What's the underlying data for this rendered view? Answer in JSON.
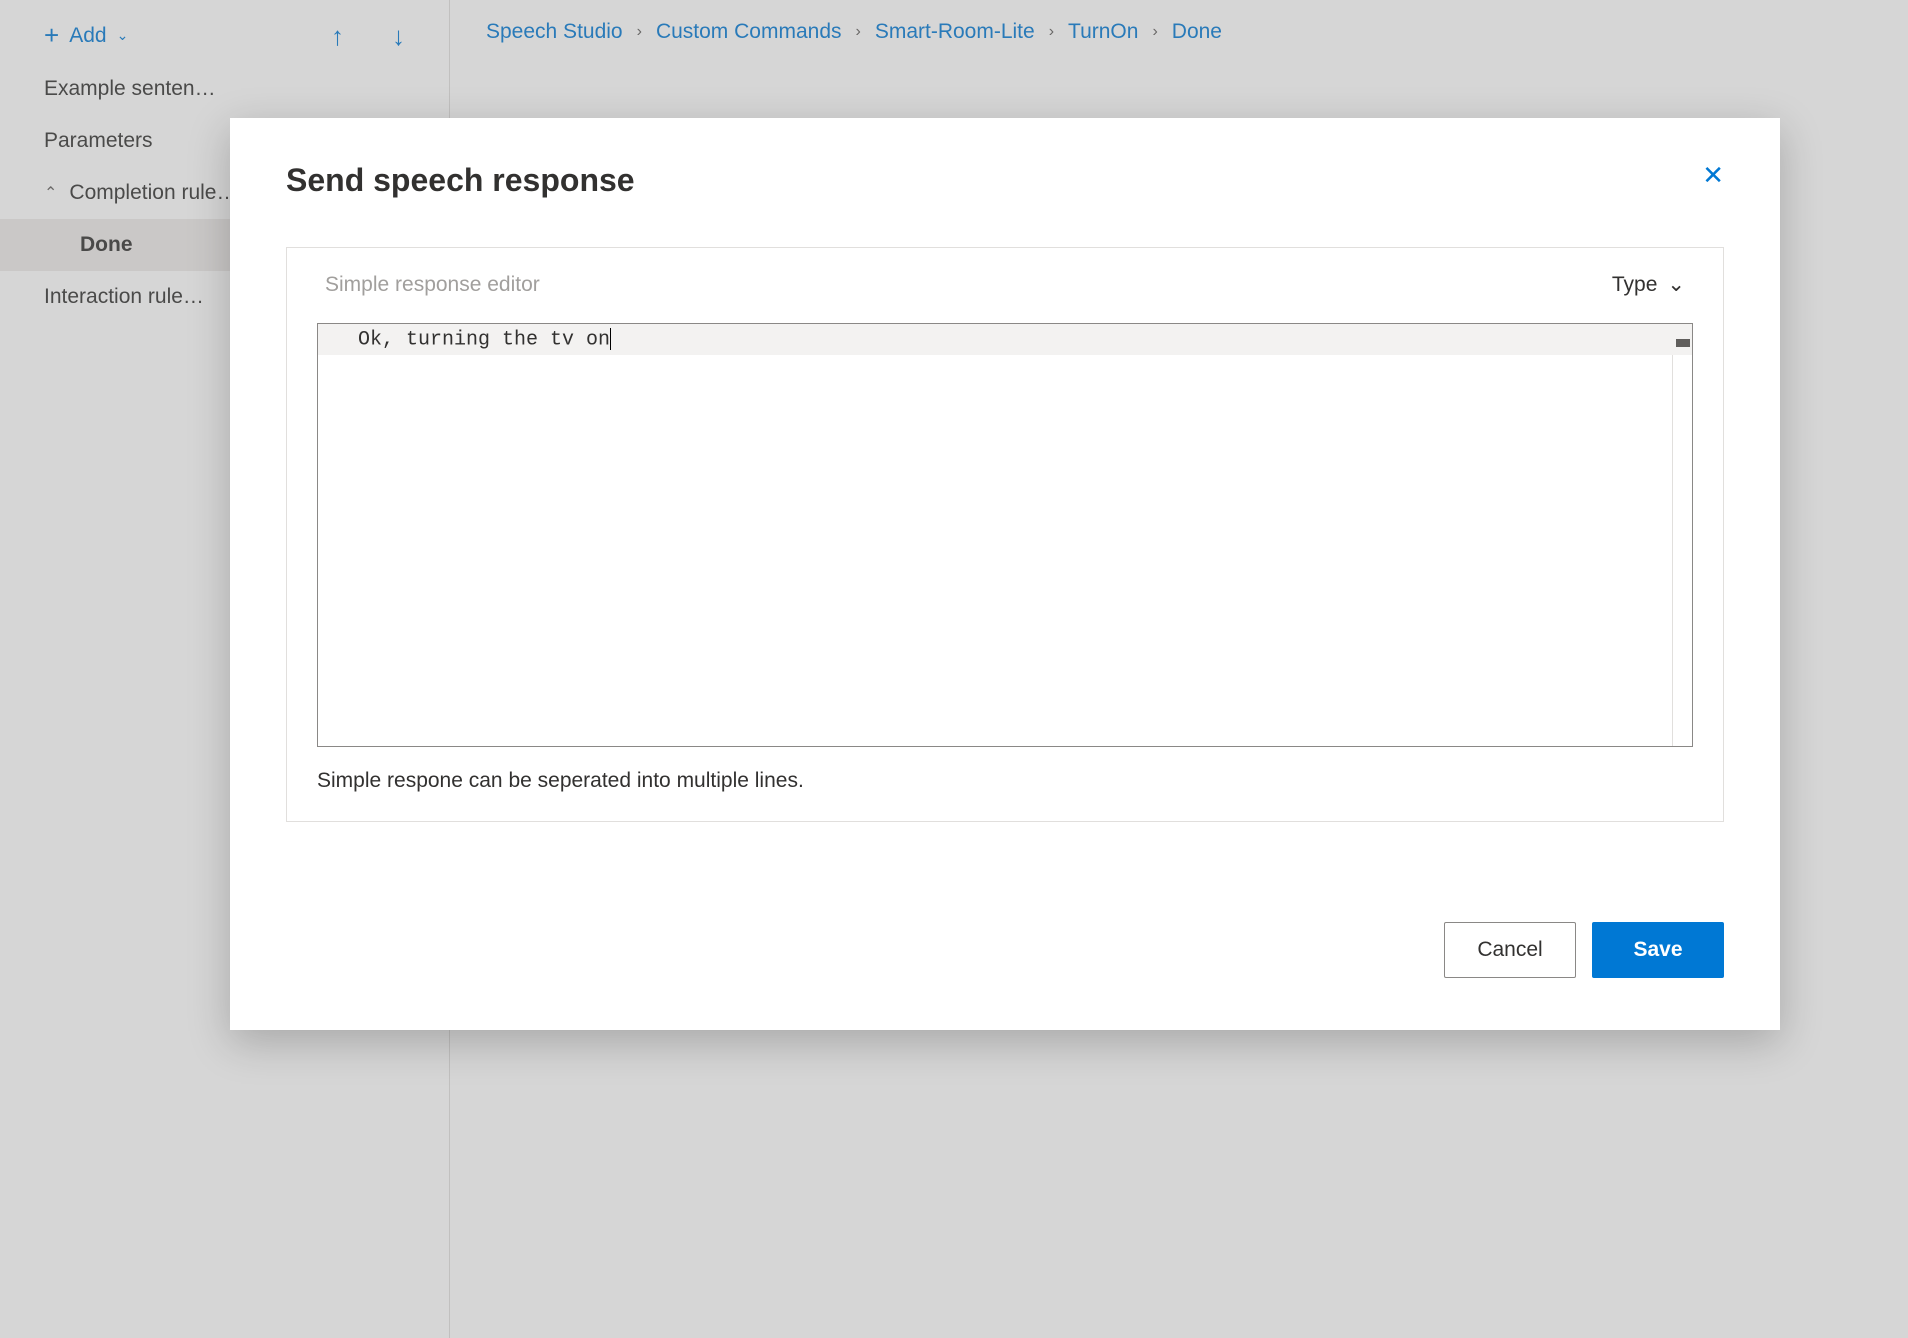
{
  "sidebar": {
    "add_label": "Add",
    "items": [
      {
        "label": "Example senten…"
      },
      {
        "label": "Parameters"
      }
    ],
    "completion_rules_label": "Completion rule…",
    "completion_subitem": "Done",
    "interaction_rules_label": "Interaction rule…"
  },
  "breadcrumb": {
    "items": [
      "Speech Studio",
      "Custom Commands",
      "Smart-Room-Lite",
      "TurnOn",
      "Done"
    ]
  },
  "modal": {
    "title": "Send speech response",
    "editor_label": "Simple response editor",
    "type_label": "Type",
    "response_text": "Ok, turning the tv on",
    "helper_text": "Simple respone can be seperated into multiple lines.",
    "cancel_label": "Cancel",
    "save_label": "Save"
  }
}
